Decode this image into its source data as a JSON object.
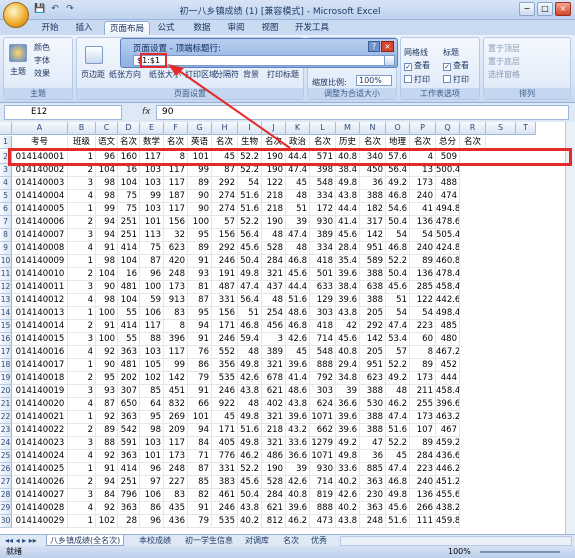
{
  "window": {
    "title": "初一八乡镇成绩 (1) [兼容模式] - Microsoft Excel",
    "controls": [
      "−",
      "□",
      "×"
    ]
  },
  "qat": [
    "💾",
    "↶",
    "↷"
  ],
  "tabs": [
    "开始",
    "插入",
    "页面布局",
    "公式",
    "数据",
    "审阅",
    "视图",
    "开发工具"
  ],
  "active_tab": "页面布局",
  "ribbon": {
    "theme": {
      "label": "主题",
      "big_button": "主题",
      "items": [
        "颜色",
        "字体",
        "效果"
      ]
    },
    "page_setup": {
      "label": "页面设置",
      "items": [
        "页边距",
        "纸张方向",
        "纸张大小",
        "打印区域",
        "分隔符",
        "背景",
        "打印标题"
      ]
    },
    "scale": {
      "label": "调整为合适大小",
      "scale_label": "缩放比例:",
      "scale_value": "100%"
    },
    "sheet_options": {
      "label": "工作表选项",
      "gridlines": "网格线",
      "headings": "标题",
      "view": "查看",
      "print": "打印"
    },
    "arrange": {
      "label": "排列",
      "items": [
        "置于顶层",
        "置于底层",
        "选择窗格"
      ]
    }
  },
  "dialog": {
    "title": "页面设置 - 顶端标题行:",
    "value": "$1:$1",
    "help": "?",
    "close": "×"
  },
  "formula_bar": {
    "cell": "E12",
    "fx": "fx",
    "value": "90"
  },
  "columns": [
    "A",
    "B",
    "C",
    "D",
    "E",
    "F",
    "G",
    "H",
    "I",
    "J",
    "K",
    "L",
    "M",
    "N",
    "O",
    "P",
    "Q",
    "R",
    "S",
    "T"
  ],
  "header_row": [
    "考号",
    "班级",
    "语文",
    "名次",
    "数学",
    "名次",
    "英语",
    "名次",
    "生物",
    "名次",
    "政治",
    "名次",
    "历史",
    "名次",
    "地理",
    "名次",
    "总分",
    "名次"
  ],
  "rows": [
    {
      "n": "2",
      "c": [
        "014140001",
        "1",
        "96",
        "160",
        "117",
        "8",
        "101",
        "45",
        "52.2",
        "190",
        "44.4",
        "571",
        "40.8",
        "340",
        "57.6",
        "4",
        "509"
      ]
    },
    {
      "n": "3",
      "c": [
        "014140002",
        "2",
        "104",
        "16",
        "103",
        "117",
        "99",
        "87",
        "52.2",
        "190",
        "47.4",
        "398",
        "38.4",
        "450",
        "56.4",
        "13",
        "500.4"
      ]
    },
    {
      "n": "4",
      "c": [
        "014140003",
        "3",
        "98",
        "104",
        "103",
        "117",
        "89",
        "292",
        "54",
        "122",
        "45",
        "548",
        "49.8",
        "36",
        "49.2",
        "173",
        "488"
      ]
    },
    {
      "n": "5",
      "c": [
        "014140004",
        "4",
        "98",
        "75",
        "99",
        "187",
        "90",
        "274",
        "51.6",
        "218",
        "48",
        "334",
        "43.8",
        "388",
        "46.8",
        "240",
        "474"
      ]
    },
    {
      "n": "6",
      "c": [
        "014140005",
        "1",
        "99",
        "75",
        "103",
        "117",
        "90",
        "274",
        "51.6",
        "218",
        "51",
        "172",
        "44.4",
        "182",
        "54.6",
        "41",
        "494.8"
      ]
    },
    {
      "n": "7",
      "c": [
        "014140006",
        "2",
        "94",
        "251",
        "101",
        "156",
        "100",
        "57",
        "52.2",
        "190",
        "39",
        "930",
        "41.4",
        "317",
        "50.4",
        "136",
        "478.6"
      ]
    },
    {
      "n": "8",
      "c": [
        "014140007",
        "3",
        "94",
        "251",
        "113",
        "32",
        "95",
        "156",
        "56.4",
        "48",
        "47.4",
        "389",
        "45.6",
        "142",
        "54",
        "54",
        "505.4"
      ]
    },
    {
      "n": "9",
      "c": [
        "014140008",
        "4",
        "91",
        "414",
        "75",
        "623",
        "89",
        "292",
        "45.6",
        "528",
        "48",
        "334",
        "28.4",
        "951",
        "46.8",
        "240",
        "424.8"
      ]
    },
    {
      "n": "10",
      "c": [
        "014140009",
        "1",
        "98",
        "104",
        "87",
        "420",
        "91",
        "246",
        "50.4",
        "284",
        "46.8",
        "418",
        "35.4",
        "589",
        "52.2",
        "89",
        "460.8"
      ]
    },
    {
      "n": "11",
      "c": [
        "014140010",
        "2",
        "104",
        "16",
        "96",
        "248",
        "93",
        "191",
        "49.8",
        "321",
        "45.6",
        "501",
        "39.6",
        "388",
        "50.4",
        "136",
        "478.4"
      ]
    },
    {
      "n": "12",
      "c": [
        "014140011",
        "3",
        "90",
        "481",
        "100",
        "173",
        "81",
        "487",
        "47.4",
        "437",
        "44.4",
        "633",
        "38.4",
        "638",
        "45.6",
        "285",
        "458.4"
      ]
    },
    {
      "n": "13",
      "c": [
        "014140012",
        "4",
        "98",
        "104",
        "59",
        "913",
        "87",
        "331",
        "56.4",
        "48",
        "51.6",
        "129",
        "39.6",
        "388",
        "51",
        "122",
        "442.6"
      ]
    },
    {
      "n": "14",
      "c": [
        "014140013",
        "1",
        "100",
        "55",
        "106",
        "83",
        "95",
        "156",
        "51",
        "254",
        "48.6",
        "303",
        "43.8",
        "205",
        "54",
        "54",
        "498.4"
      ]
    },
    {
      "n": "15",
      "c": [
        "014140014",
        "2",
        "91",
        "414",
        "117",
        "8",
        "94",
        "171",
        "46.8",
        "456",
        "46.8",
        "418",
        "42",
        "292",
        "47.4",
        "223",
        "485"
      ]
    },
    {
      "n": "16",
      "c": [
        "014140015",
        "3",
        "100",
        "55",
        "88",
        "396",
        "91",
        "246",
        "59.4",
        "3",
        "42.6",
        "714",
        "45.6",
        "142",
        "53.4",
        "60",
        "480"
      ]
    },
    {
      "n": "17",
      "c": [
        "014140016",
        "4",
        "92",
        "363",
        "103",
        "117",
        "76",
        "552",
        "48",
        "389",
        "45",
        "548",
        "40.8",
        "205",
        "57",
        "8",
        "467.2"
      ]
    },
    {
      "n": "18",
      "c": [
        "014140017",
        "1",
        "90",
        "481",
        "105",
        "99",
        "86",
        "356",
        "49.8",
        "321",
        "39.6",
        "888",
        "29.4",
        "951",
        "52.2",
        "89",
        "452"
      ]
    },
    {
      "n": "19",
      "c": [
        "014140018",
        "2",
        "95",
        "202",
        "102",
        "142",
        "79",
        "535",
        "42.6",
        "678",
        "41.4",
        "792",
        "34.8",
        "623",
        "49.2",
        "173",
        "444"
      ]
    },
    {
      "n": "20",
      "c": [
        "014140019",
        "3",
        "93",
        "307",
        "85",
        "451",
        "91",
        "246",
        "43.8",
        "621",
        "48.6",
        "303",
        "39",
        "388",
        "48",
        "211",
        "458.4"
      ]
    },
    {
      "n": "21",
      "c": [
        "014140020",
        "4",
        "87",
        "650",
        "64",
        "832",
        "66",
        "922",
        "48",
        "402",
        "43.8",
        "624",
        "36.6",
        "530",
        "46.2",
        "255",
        "396.6"
      ]
    },
    {
      "n": "22",
      "c": [
        "014140021",
        "1",
        "92",
        "363",
        "95",
        "269",
        "101",
        "45",
        "49.8",
        "321",
        "39.6",
        "1071",
        "39.6",
        "388",
        "47.4",
        "173",
        "463.2"
      ]
    },
    {
      "n": "23",
      "c": [
        "014140022",
        "2",
        "89",
        "542",
        "98",
        "209",
        "94",
        "171",
        "51.6",
        "218",
        "43.2",
        "662",
        "39.6",
        "388",
        "51.6",
        "107",
        "467"
      ]
    },
    {
      "n": "24",
      "c": [
        "014140023",
        "3",
        "88",
        "591",
        "103",
        "117",
        "84",
        "405",
        "49.8",
        "321",
        "33.6",
        "1279",
        "49.2",
        "47",
        "52.2",
        "89",
        "459.2"
      ]
    },
    {
      "n": "25",
      "c": [
        "014140024",
        "4",
        "92",
        "363",
        "101",
        "173",
        "71",
        "776",
        "46.2",
        "486",
        "36.6",
        "1071",
        "49.8",
        "36",
        "45",
        "284",
        "436.6"
      ]
    },
    {
      "n": "26",
      "c": [
        "014140025",
        "1",
        "91",
        "414",
        "96",
        "248",
        "87",
        "331",
        "52.2",
        "190",
        "39",
        "930",
        "33.6",
        "885",
        "47.4",
        "223",
        "446.2"
      ]
    },
    {
      "n": "27",
      "c": [
        "014140026",
        "2",
        "94",
        "251",
        "97",
        "227",
        "85",
        "383",
        "45.6",
        "528",
        "42.6",
        "714",
        "40.2",
        "363",
        "46.8",
        "240",
        "451.2"
      ]
    },
    {
      "n": "28",
      "c": [
        "014140027",
        "3",
        "84",
        "796",
        "106",
        "83",
        "82",
        "461",
        "50.4",
        "284",
        "40.8",
        "819",
        "42.6",
        "230",
        "49.8",
        "136",
        "455.6"
      ]
    },
    {
      "n": "29",
      "c": [
        "014140028",
        "4",
        "92",
        "363",
        "86",
        "435",
        "91",
        "246",
        "43.8",
        "621",
        "39.6",
        "888",
        "40.2",
        "363",
        "45.6",
        "266",
        "438.2"
      ]
    },
    {
      "n": "30",
      "c": [
        "014140029",
        "1",
        "102",
        "28",
        "96",
        "436",
        "79",
        "535",
        "40.2",
        "812",
        "46.2",
        "473",
        "43.8",
        "248",
        "51.6",
        "111",
        "459.8"
      ]
    }
  ],
  "sheet_tabs": [
    "八乡镇成绩(全名次)",
    "本校成绩",
    "初一学生信息",
    "对调库",
    "名次",
    "优秀"
  ],
  "status": {
    "left": "就绪",
    "zoom": "100%"
  }
}
